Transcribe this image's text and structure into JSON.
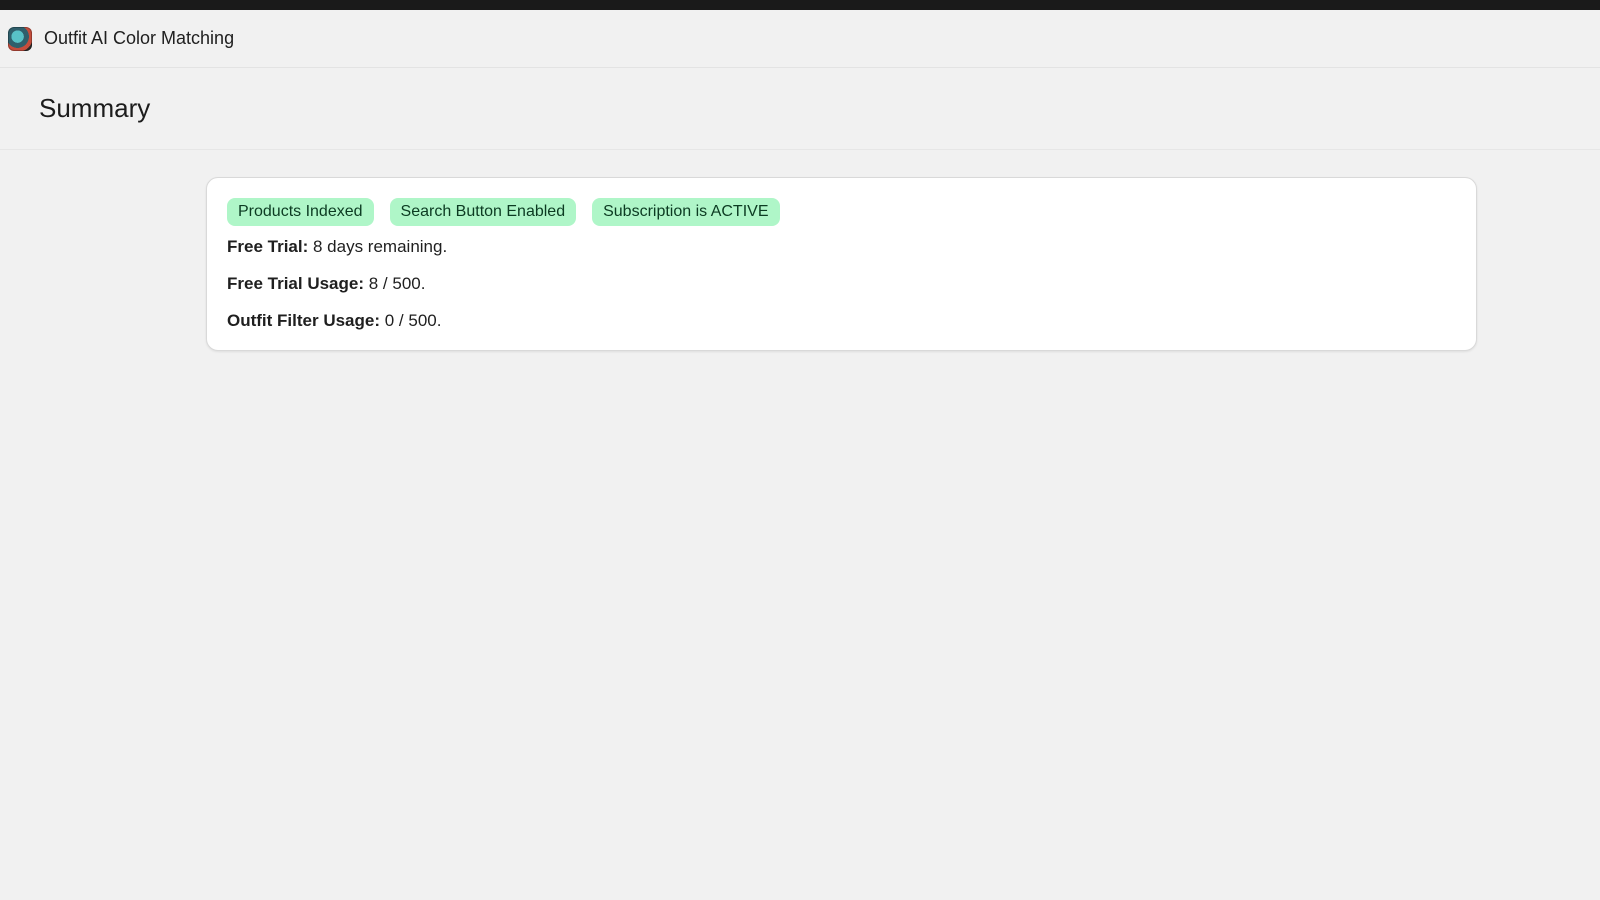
{
  "app": {
    "title": "Outfit AI Color Matching",
    "logo_icon": "app-logo-icon"
  },
  "page": {
    "title": "Summary"
  },
  "summary": {
    "badges": [
      {
        "label": "Products Indexed",
        "color": "#aff6c8"
      },
      {
        "label": "Search Button Enabled",
        "color": "#aff6c8"
      },
      {
        "label": "Subscription is ACTIVE",
        "color": "#aff6c8"
      }
    ],
    "rows": [
      {
        "label": "Free Trial:",
        "value": "8 days remaining."
      },
      {
        "label": "Free Trial Usage:",
        "value": "8 / 500."
      },
      {
        "label": "Outfit Filter Usage:",
        "value": "0 / 500."
      }
    ]
  },
  "colors": {
    "background": "#f1f1f1",
    "topbar": "#1a1a1a",
    "card": "#ffffff",
    "badge_success": "#aff6c8"
  }
}
